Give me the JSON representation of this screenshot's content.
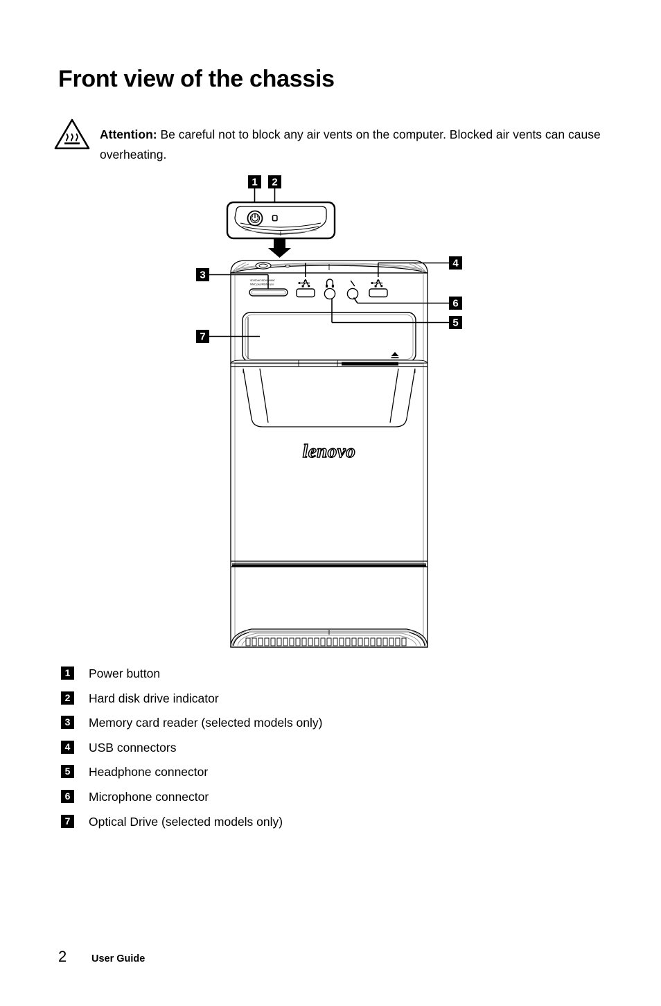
{
  "page": {
    "title": "Front view of the chassis"
  },
  "attention": {
    "icon": "hot-surface-warning-icon",
    "lead": "Attention:",
    "body": " Be careful not to block any air vents on the computer. Blocked air vents can cause overheating."
  },
  "diagram": {
    "name": "front-view-of-chassis-diagram",
    "product_logo": "lenovo",
    "card_reader_label_line1": "SD/SDHC/SDXC/MMC",
    "card_reader_label_line2": "MMC plus/MS/MS pro",
    "callouts": [
      {
        "number": "1",
        "target": "power-button"
      },
      {
        "number": "2",
        "target": "hard-disk-drive-indicator"
      },
      {
        "number": "3",
        "target": "memory-card-reader"
      },
      {
        "number": "4",
        "target": "usb-connectors"
      },
      {
        "number": "5",
        "target": "headphone-connector"
      },
      {
        "number": "6",
        "target": "microphone-connector"
      },
      {
        "number": "7",
        "target": "optical-drive"
      }
    ],
    "icons": {
      "power": "power-symbol-icon",
      "hdd": "hdd-indicator-icon",
      "usb": "usb-icon",
      "headphone": "headphone-icon",
      "microphone": "microphone-icon",
      "eject": "eject-icon"
    }
  },
  "legend": {
    "items": [
      {
        "number": "1",
        "label": "Power button"
      },
      {
        "number": "2",
        "label": "Hard disk drive indicator"
      },
      {
        "number": "3",
        "label": "Memory card reader (selected models only)"
      },
      {
        "number": "4",
        "label": "USB connectors"
      },
      {
        "number": "5",
        "label": "Headphone connector"
      },
      {
        "number": "6",
        "label": "Microphone connector"
      },
      {
        "number": "7",
        "label": "Optical Drive (selected models only)"
      }
    ]
  },
  "footer": {
    "page_number": "2",
    "document_name": "User Guide"
  },
  "colors": {
    "ink": "#000000",
    "paper": "#ffffff",
    "line_light": "#8c8c8c"
  }
}
